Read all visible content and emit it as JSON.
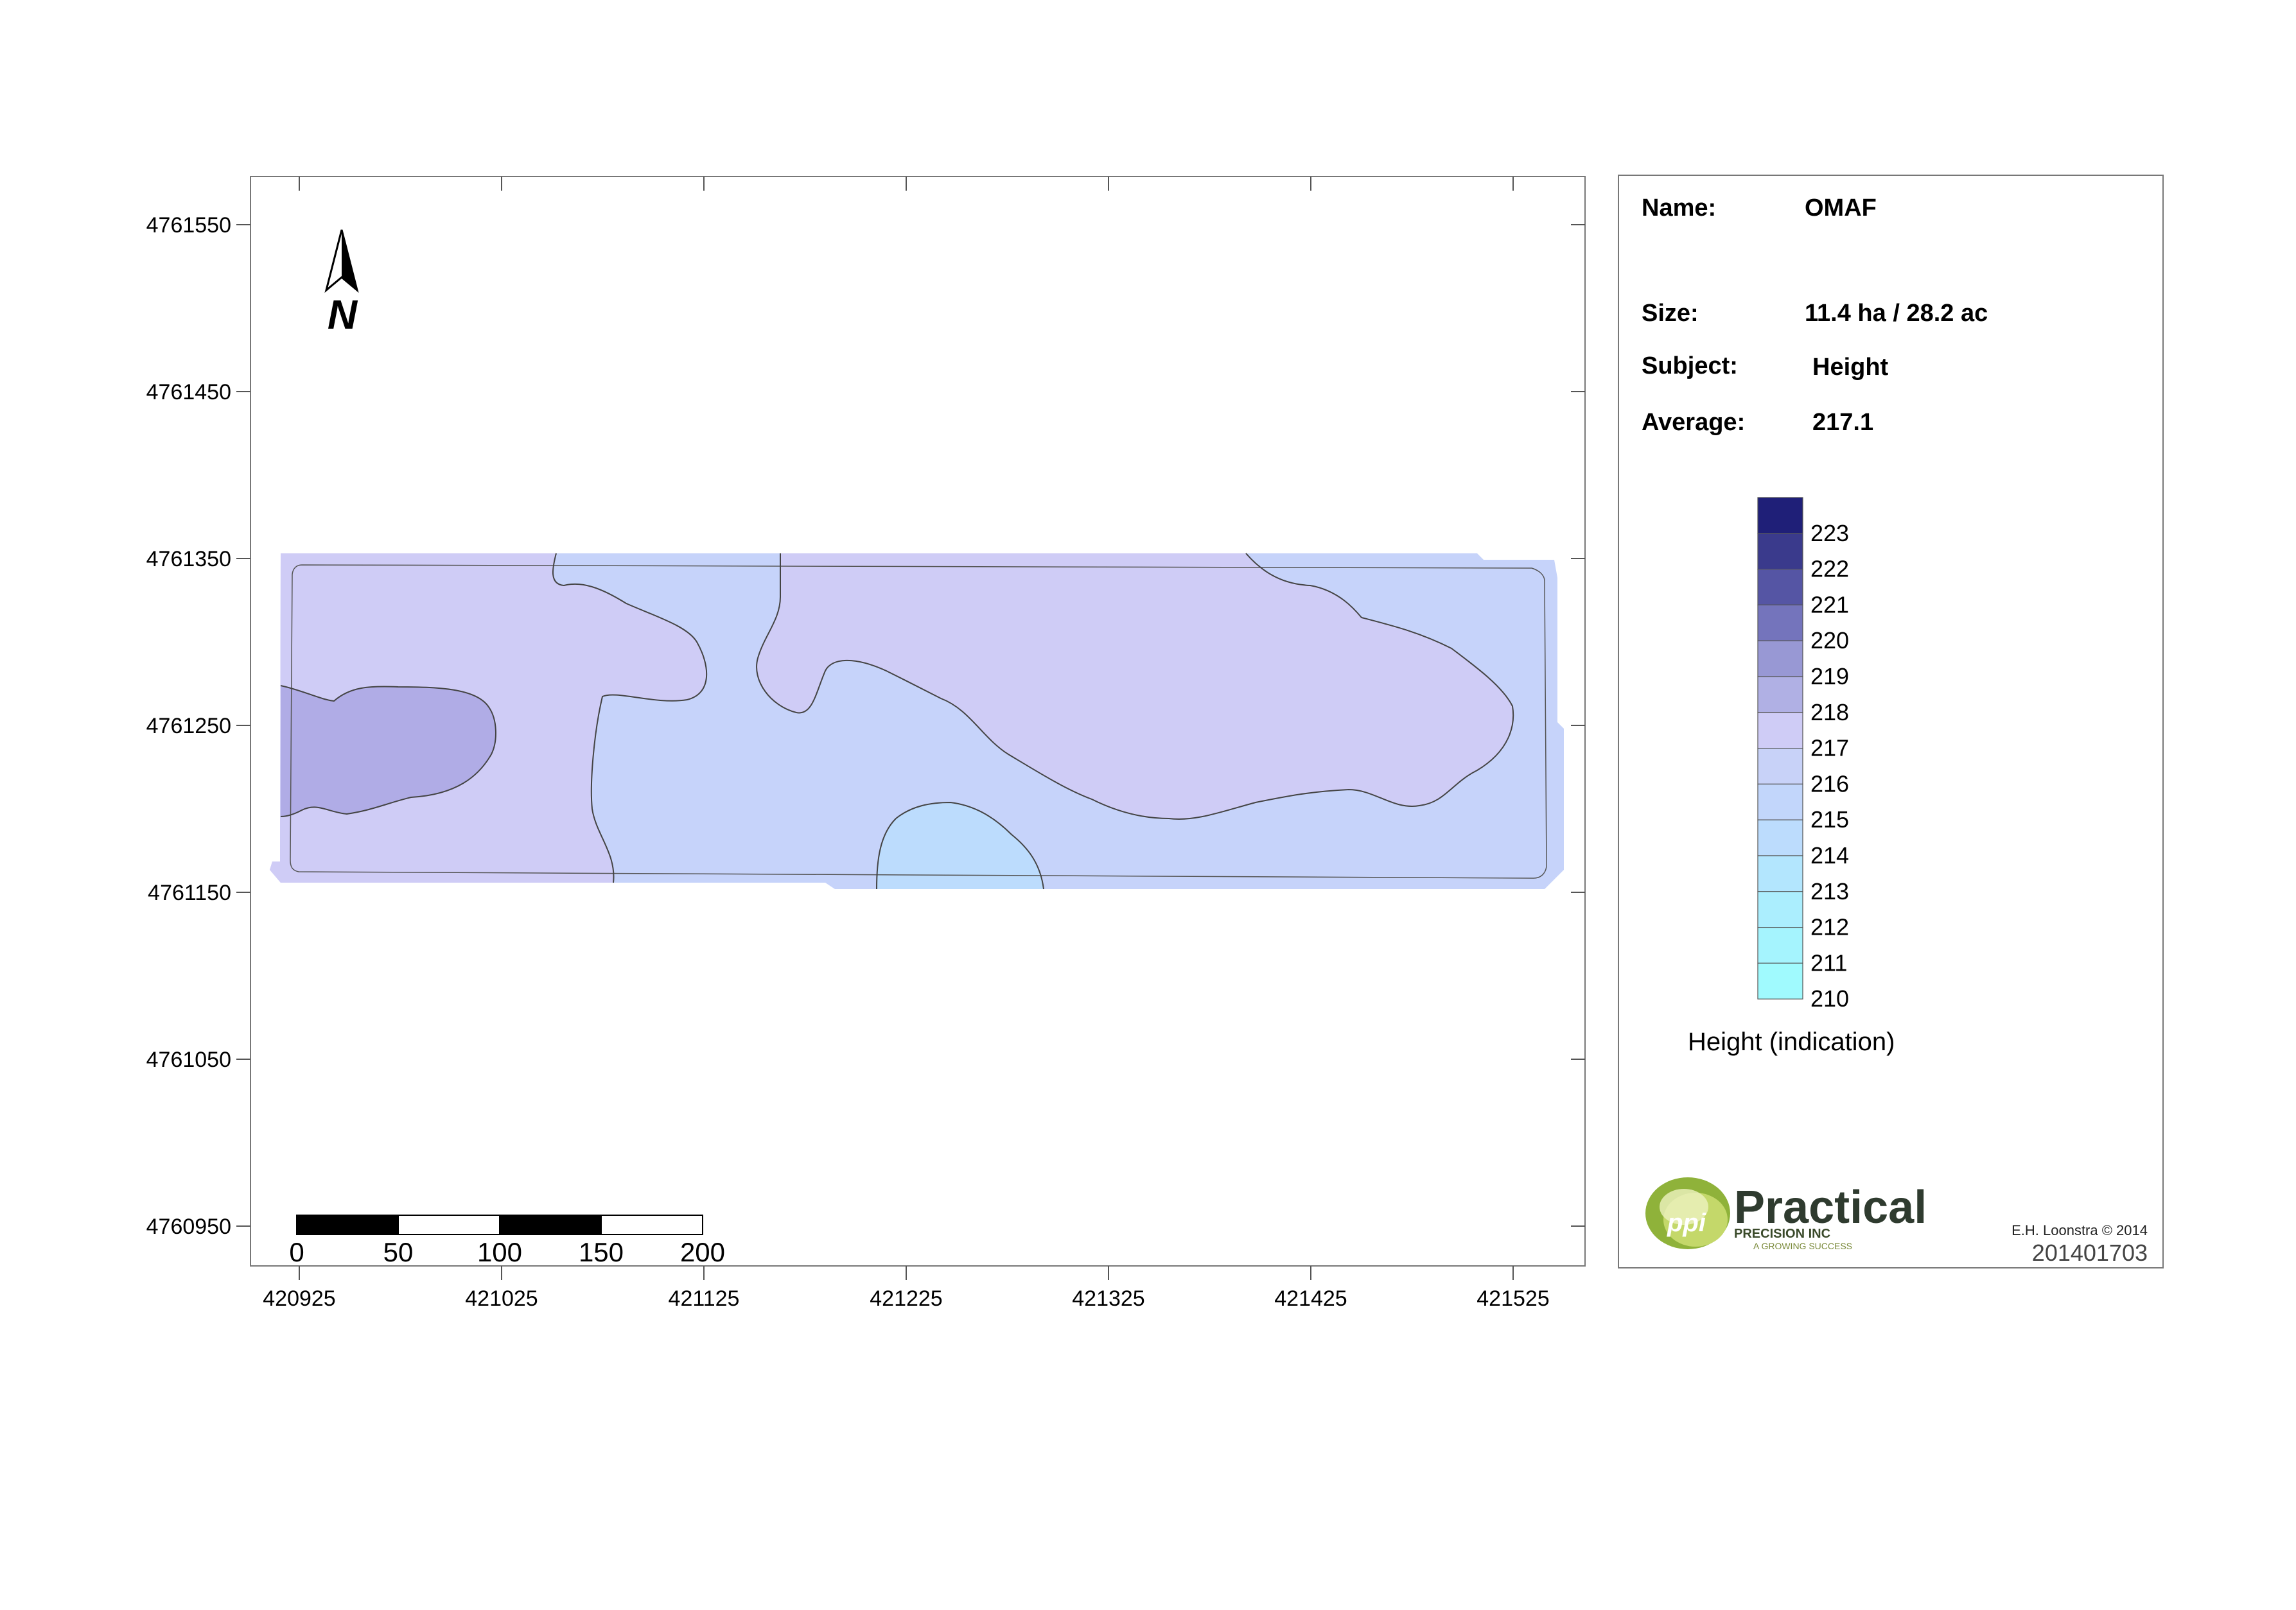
{
  "map": {
    "y_ticks": [
      "4761550",
      "4761450",
      "4761350",
      "4761250",
      "4761150",
      "4761050",
      "4760950"
    ],
    "x_ticks": [
      "420925",
      "421025",
      "421125",
      "421225",
      "421325",
      "421425",
      "421525"
    ],
    "north_label": "N",
    "scale_labels": [
      "0",
      "50",
      "100",
      "150",
      "200"
    ]
  },
  "info": {
    "name_label": "Name:",
    "name_value": "OMAF",
    "size_label": "Size:",
    "size_value": "11.4 ha / 28.2 ac",
    "subject_label": "Subject:",
    "subject_value": "Height",
    "average_label": "Average:",
    "average_value": "217.1"
  },
  "legend": {
    "title": "Height (indication)",
    "classes": [
      {
        "value": "223",
        "color": "#1f1f78"
      },
      {
        "value": "222",
        "color": "#3a3a8c"
      },
      {
        "value": "221",
        "color": "#5555a4"
      },
      {
        "value": "220",
        "color": "#7474bc"
      },
      {
        "value": "219",
        "color": "#9898d4"
      },
      {
        "value": "218",
        "color": "#b0b0e4"
      },
      {
        "value": "217",
        "color": "#cfccf6"
      },
      {
        "value": "216",
        "color": "#c8d2f8"
      },
      {
        "value": "215",
        "color": "#c2d6fb"
      },
      {
        "value": "214",
        "color": "#bcdcfd"
      },
      {
        "value": "213",
        "color": "#b3e6fe"
      },
      {
        "value": "212",
        "color": "#abeefe"
      },
      {
        "value": "211",
        "color": "#a5f4fe"
      },
      {
        "value": "210",
        "color": "#a0fafe"
      }
    ]
  },
  "footer": {
    "logo_text": "Practical",
    "logo_sub": "PRECISION INC",
    "logo_tagline": "A GROWING SUCCESS",
    "logo_mark": "ppi",
    "credit": "E.H. Loonstra © 2014",
    "document_number": "201401703"
  },
  "colors": {
    "zone_219": "#b0ace6",
    "zone_218": "#cfccf6",
    "zone_217": "#c6d3fa",
    "zone_216": "#bcdcfd",
    "field_boundary": "#c6d3fa",
    "contour": "#333333"
  }
}
